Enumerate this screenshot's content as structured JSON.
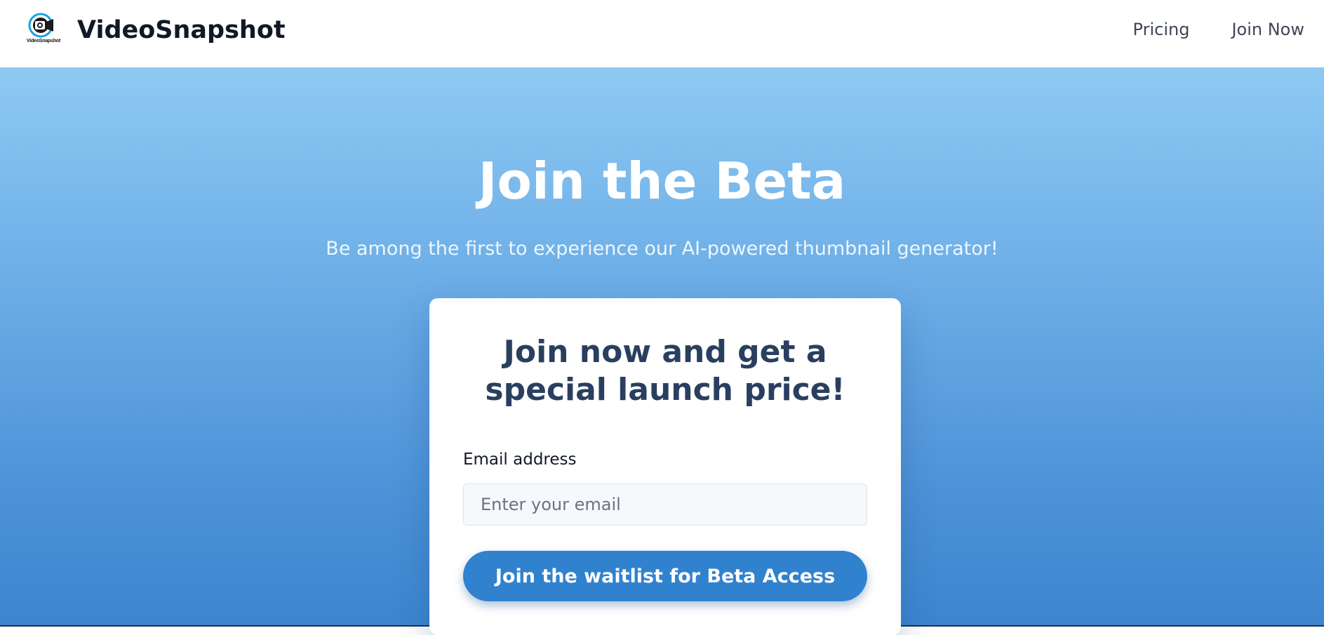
{
  "header": {
    "brand_name": "VideoSnapshot",
    "logo_text": "VideoSnapshot",
    "logo_icon": "video-camera-icon",
    "nav": [
      {
        "label": "Pricing"
      },
      {
        "label": "Join Now"
      }
    ]
  },
  "hero": {
    "title": "Join the Beta",
    "subtitle": "Be among the first to experience our AI-powered thumbnail generator!"
  },
  "signup_card": {
    "title": "Join now and get a special launch price!",
    "email_label": "Email address",
    "email_value": "",
    "email_placeholder": "Enter your email",
    "submit_label": "Join the waitlist for Beta Access"
  },
  "colors": {
    "accent": "#3182ce",
    "hero_gradient_top": "#8ec9f3",
    "hero_gradient_bottom": "#3c85d0",
    "card_title": "#2a3f5f"
  }
}
